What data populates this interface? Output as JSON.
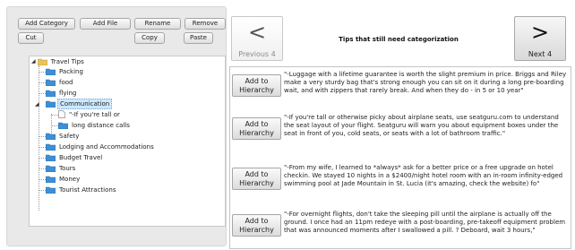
{
  "toolbar": {
    "add_category": "Add Category",
    "add_file": "Add File",
    "rename": "Rename",
    "remove": "Remove",
    "cut": "Cut",
    "copy": "Copy",
    "paste": "Paste"
  },
  "tree": {
    "root": "Travel Tips",
    "items": [
      {
        "label": "Packing"
      },
      {
        "label": "food"
      },
      {
        "label": "flying"
      },
      {
        "label": "Communication",
        "selected": true
      },
      {
        "label": "\"-If you're tall or"
      },
      {
        "label": "long distance calls"
      },
      {
        "label": "Safety"
      },
      {
        "label": "Lodging and Accommodations"
      },
      {
        "label": "Budget Travel"
      },
      {
        "label": "Tours"
      },
      {
        "label": "Money"
      },
      {
        "label": "Tourist Attractions"
      }
    ]
  },
  "nav": {
    "prev_arrow": "<",
    "prev_label": "Previous 4",
    "next_arrow": ">",
    "next_label": "Next 4",
    "title": "Tips that still need categorization"
  },
  "tips": {
    "add_label_1": "Add to",
    "add_label_2": "Hierarchy",
    "items": [
      {
        "text": "\"-Luggage with a lifetime guarantee is worth the slight premium in price. Briggs and Riley make a very sturdy bag that's strong enough you can sit on it during a long pre-boarding wait, and with zippers that rarely break. And when they do - in 5 or 10 year\""
      },
      {
        "text": "\"-If you're tall or otherwise picky about airplane seats, use seatguru.com to understand the seat layout of your flight. Seatguru will warn you about equipment boxes under the seat in front of you, cold seats, or seats with a lot of bathroom traffic.\""
      },
      {
        "text": "\"-From my wife, I learned to *always* ask for a better price or a free upgrade on hotel checkin. We stayed 10 nights in a $2400/night hotel room with an in-room infinity-edged swimming pool at Jade Mountain in St. Lucia (it's amazing, check the website) fo\""
      },
      {
        "text": "\"-For overnight flights, don't take the sleeping pill until the airplane is actually off the ground. I once had an 11pm redeye with a post-boarding, pre-takeoff equipment problem that was announced moments after I swallowed a pill. ? Deboard, wait 3 hours,\""
      }
    ]
  },
  "colors": {
    "folder_blue": "#3d8fd6",
    "folder_yellow": "#e8c35a",
    "selection": "#cde8ff"
  }
}
